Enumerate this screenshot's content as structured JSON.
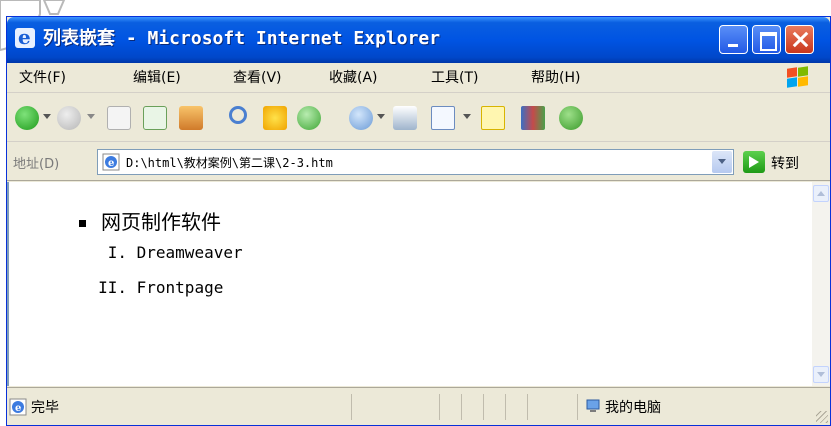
{
  "window": {
    "title": "列表嵌套 - Microsoft Internet Explorer"
  },
  "menu": {
    "items": [
      {
        "label": "文件(F)"
      },
      {
        "label": "编辑(E)"
      },
      {
        "label": "查看(V)"
      },
      {
        "label": "收藏(A)"
      },
      {
        "label": "工具(T)"
      },
      {
        "label": "帮助(H)"
      }
    ]
  },
  "toolbar": {
    "icons": [
      "back-icon",
      "forward-icon",
      "stop-icon",
      "refresh-icon",
      "home-icon",
      "search-icon",
      "favorites-icon",
      "history-icon",
      "mail-icon",
      "print-icon",
      "edit-icon",
      "discuss-icon",
      "research-icon",
      "messenger-icon"
    ]
  },
  "address": {
    "label": "地址(D)",
    "value": "D:\\html\\教材案例\\第二课\\2-3.htm",
    "go_label": "转到"
  },
  "content": {
    "list": {
      "label": "网页制作软件",
      "items": [
        {
          "num": "I.",
          "text": "Dreamweaver"
        },
        {
          "num": "II.",
          "text": "Frontpage"
        }
      ]
    }
  },
  "status": {
    "text": "完毕",
    "zone": "我的电脑"
  },
  "colors": {
    "titlebar": "#0054e3",
    "close_button": "#c9361c",
    "chrome": "#ece9d8"
  }
}
